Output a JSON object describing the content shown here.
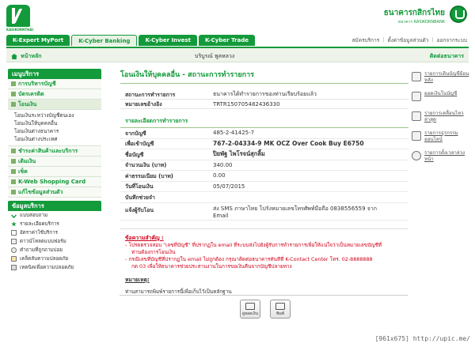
{
  "header": {
    "logo_text": "KASIKORNTHAI",
    "bank_name_th": "ธนาคารกสิกรไทย",
    "bank_name_en": "ธนาคาร KASIKORNBANK"
  },
  "topnav": {
    "tabs": [
      "K-Expert MyPort",
      "K-Cyber Banking",
      "K-Cyber Invest",
      "K-Cyber Trade"
    ]
  },
  "toplinks": [
    "สมัครบริการ",
    "ตั้งค่าข้อมูลส่วนตัว",
    "ออกจากระบบ"
  ],
  "subbar": {
    "home": "หน้าหลัก",
    "username": "บริบูรณ์ พูลหลวง",
    "contact": "ติดต่อธนาคาร"
  },
  "sidebar": {
    "menu_title": "เมนูบริการ",
    "items": [
      "การบริหารบัญชี",
      "บัตรเครดิต",
      "โอนเงิน"
    ],
    "transfer_sub": [
      "โอนเงินระหว่างบัญชีตนเอง",
      "โอนเงินให้บุคคลอื่น",
      "โอนเงินต่างธนาคาร",
      "โอนเงินต่างประเทศ"
    ],
    "items2": [
      "ชำระค่าสินค้าและบริการ",
      "เติมเงิน",
      "เช็ค",
      "K-Web Shopping Card",
      "แก้ไขข้อมูลส่วนตัว"
    ],
    "services_title": "ข้อมูลบริการ",
    "services": [
      "แบบสอบถาม",
      "รายละเอียดบริการ",
      "อัตราค่าใช้บริการ",
      "ดาวน์โหลดแบบฟอร์ม",
      "คำถามที่ถูกถามบ่อย",
      "เคล็ดลับความปลอดภัย",
      "เทคนิคเพื่อความปลอดภัย"
    ]
  },
  "main": {
    "title": "โอนเงินให้บุคคลอื่น - สถานะการทำรายการ",
    "status_label": "สถานะการทำรายการ",
    "status_value": "ธนาคารได้ทำรายการของท่านเรียบร้อยแล้ว",
    "ref_label": "หมายเลขอ้างอิง",
    "ref_value": "TRTR150705482436330",
    "detail_title": "รายละเอียดการทำรายการ",
    "details": [
      {
        "k": "จากบัญชี",
        "v": "485-2-41425-7"
      },
      {
        "k": "เพื่อเข้าบัญชี",
        "v": "767-2-04334-9 MK OCZ Over Cook Buy E6750"
      },
      {
        "k": "ชื่อบัญชี",
        "v": "ปิยพัฐ ไพโรจน์สุกลิ้ม"
      },
      {
        "k": "จำนวนเงิน (บาท)",
        "v": "340.00"
      },
      {
        "k": "ค่าธรรมเนียม (บาท)",
        "v": "0.00"
      },
      {
        "k": "วันที่โอนเงิน",
        "v": "05/07/2015"
      },
      {
        "k": "บันทึกช่วยจำ",
        "v": ""
      },
      {
        "k": "แจ้งผู้รับโอน",
        "v": "ส่ง SMS ภาษาไทย โปรังหมายเลขโทรศัพท์มือถือ 0838556559 จาก Email"
      }
    ],
    "notice_title": "ข้อความสำคัญ :",
    "notice_lines": [
      "- โปรดตรวจสอบ \"เลขที่บัญชี\" ที่ปรากฏใน email ที่ระบบส่งไปยังผู้รับการทำรายการเพื่อให้แน่ใจว่าเป็นหมายเลขบัญชีที่",
      "ท่านต้องการโอนเงิน",
      "- กรณีเลขที่บัญชีที่ปรากฏใน email ไม่ถูกต้อง กรุณาติดต่อธนาคารทันทีที่ K-Contact Center โทร. 02-8888888",
      "กด 03 เพื่อให้ธนาคารช่วยประสานงานในการขอเงินคืนจากบัญชีปลายทาง"
    ],
    "note_title": "หมายเหตุ:",
    "note_text": "ท่านสามารถพิมพ์รายการนี้เพื่อเก็บไว้เป็นหลักฐาน",
    "btn_view": "ดูยอดเงิน",
    "btn_print": "พิมพ์"
  },
  "quick_links": [
    "รายการเดินบัญชีย้อนหลัง",
    "ยอดเงินในบัญชี",
    "รายการเคลื่อนไหวล่าสุด",
    "รายการธุรกรรมออนไลน์",
    "รายการตั้งเวลาล่วงหน้า"
  ],
  "watermark": "[961x675] http://upic.me/",
  "colors": {
    "brand": "#139a3b",
    "alert": "#d0021b"
  }
}
